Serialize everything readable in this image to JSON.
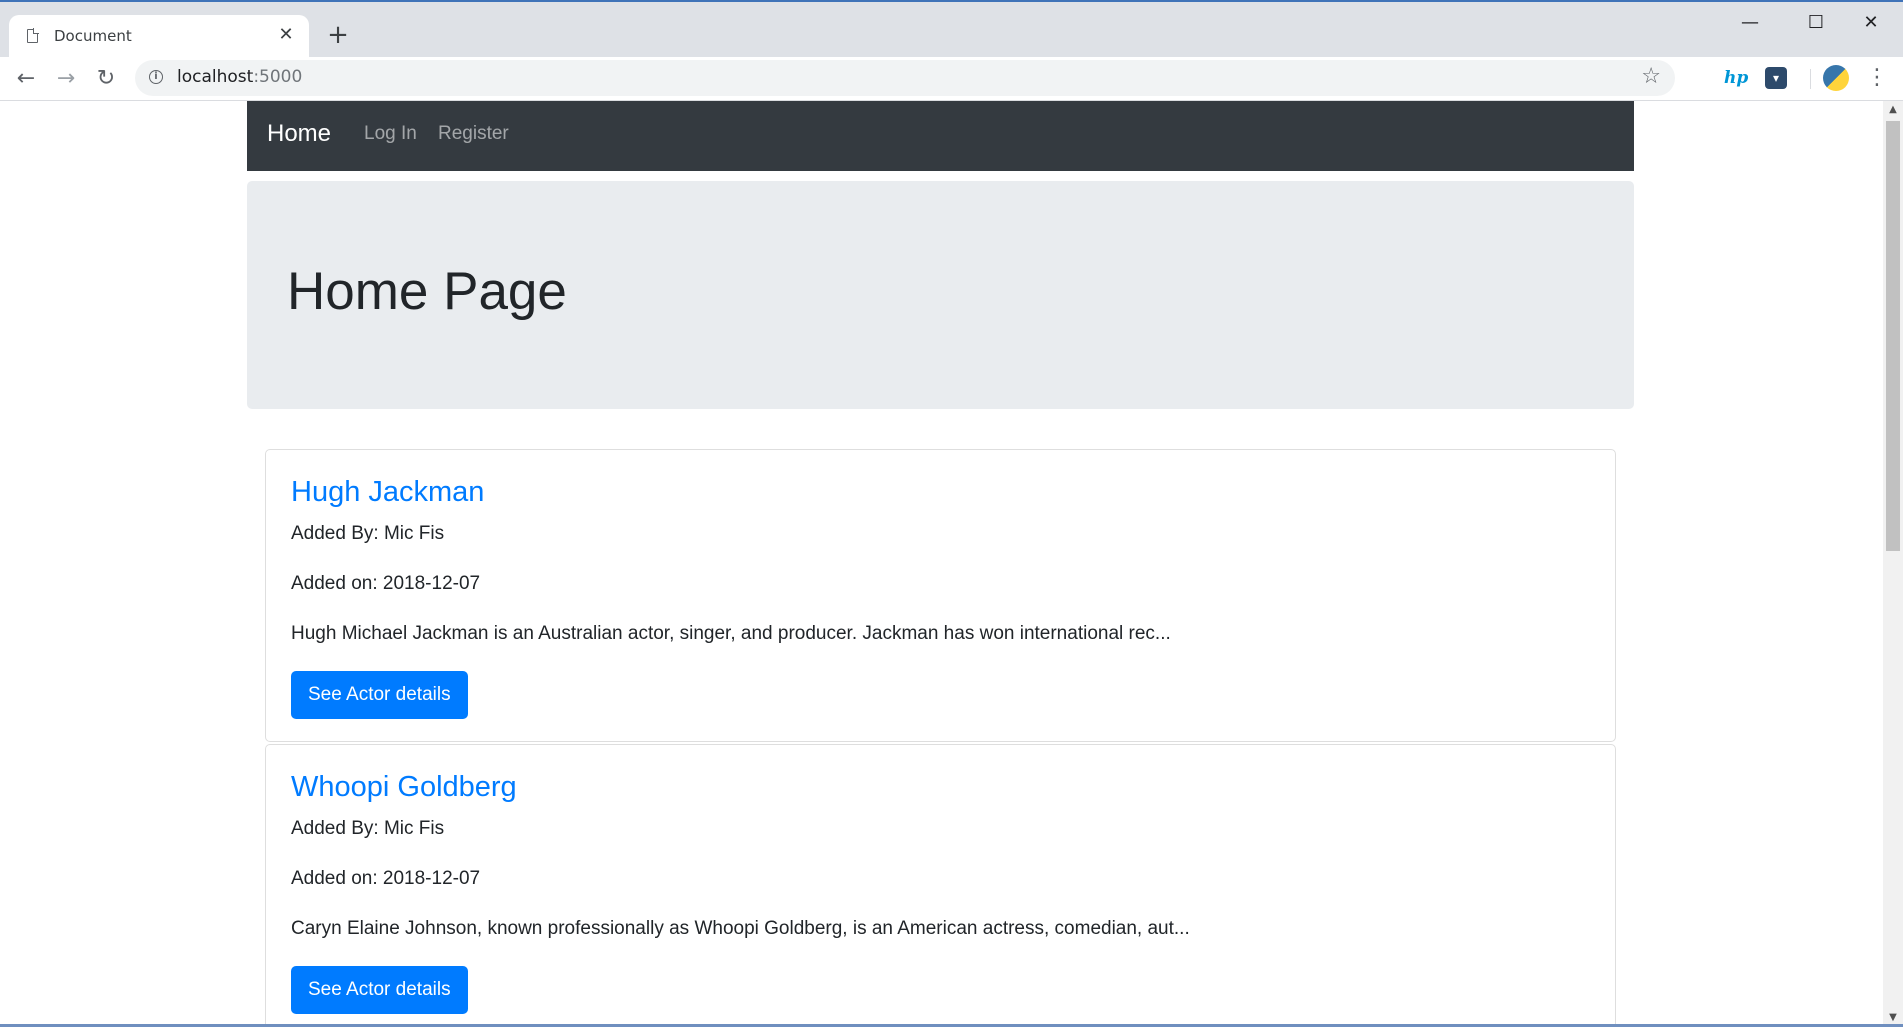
{
  "browser": {
    "tab_title": "Document",
    "tab_close": "✕",
    "new_tab": "+",
    "url_host": "localhost",
    "url_port": ":5000",
    "window_controls": {
      "minimize": "—",
      "maximize": "☐",
      "close": "✕"
    },
    "nav": {
      "back": "←",
      "forward": "→",
      "reload": "↻"
    },
    "star": "☆",
    "menu": "⋮",
    "ext_hp": "hp",
    "ext_box": "▾"
  },
  "navbar": {
    "brand": "Home",
    "links": [
      "Log In",
      "Register"
    ]
  },
  "jumbotron": {
    "title": "Home Page"
  },
  "actors": [
    {
      "name": "Hugh Jackman",
      "added_by": "Added By: Mic Fis",
      "added_on": "Added on: 2018-12-07",
      "summary": "Hugh Michael Jackman is an Australian actor, singer, and producer. Jackman has won international rec...",
      "button": "See Actor details"
    },
    {
      "name": "Whoopi Goldberg",
      "added_by": "Added By: Mic Fis",
      "added_on": "Added on: 2018-12-07",
      "summary": "Caryn Elaine Johnson, known professionally as Whoopi Goldberg, is an American actress, comedian, aut...",
      "button": "See Actor details"
    }
  ],
  "colors": {
    "navbar_bg": "#343a40",
    "jumbotron_bg": "#e9ecef",
    "primary": "#007bff"
  }
}
